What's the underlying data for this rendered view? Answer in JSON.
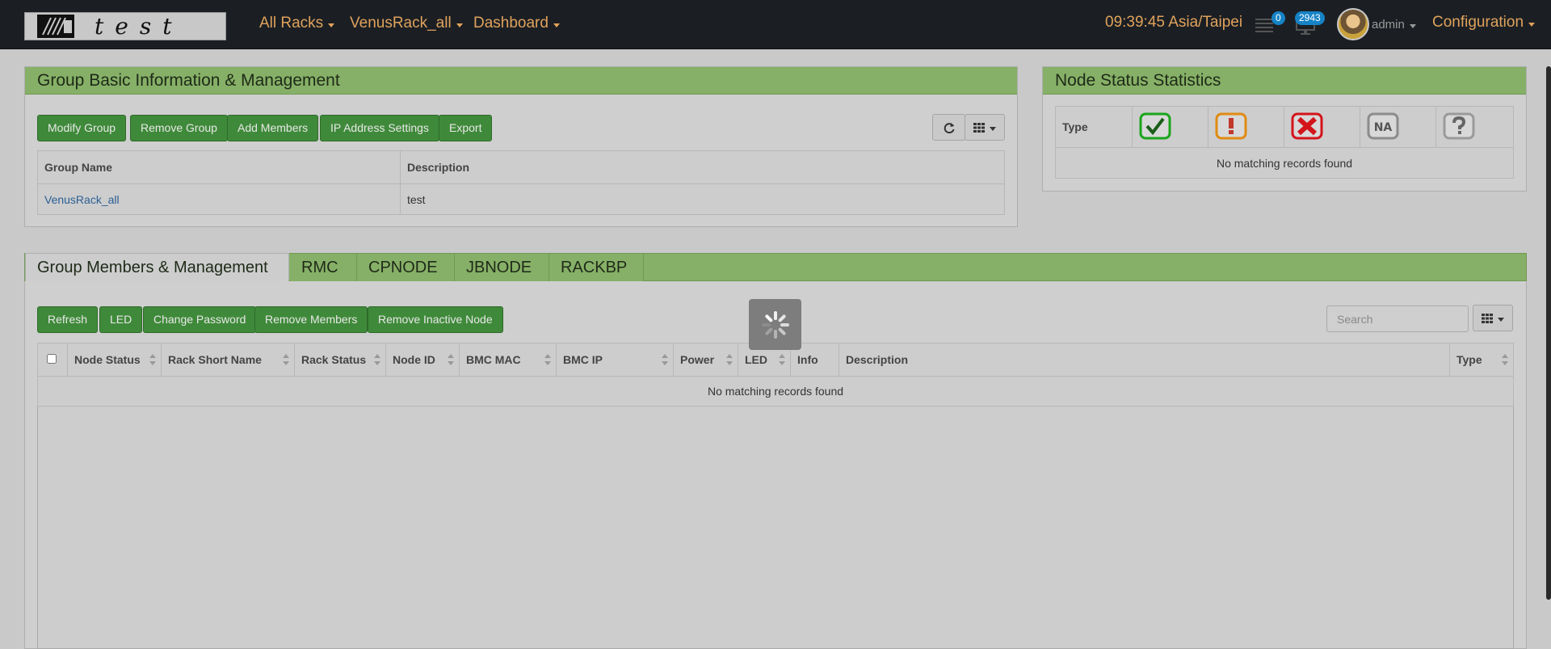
{
  "brand": {
    "logo_text": "test"
  },
  "nav": {
    "menus": [
      {
        "label": "All Racks"
      },
      {
        "label": "VenusRack_all"
      },
      {
        "label": "Dashboard"
      }
    ],
    "clock": "09:39:45 Asia/Taipei",
    "notifications_count": "0",
    "alerts_count": "2943",
    "user": "admin",
    "configuration": "Configuration"
  },
  "group_info": {
    "title": "Group Basic Information & Management",
    "buttons": [
      "Modify Group",
      "Remove Group",
      "Add Members",
      "IP Address Settings",
      "Export"
    ],
    "columns": [
      "Group Name",
      "Description"
    ],
    "rows": [
      {
        "name": "VenusRack_all",
        "description": "test"
      }
    ]
  },
  "node_stats": {
    "title": "Node Status Statistics",
    "type_label": "Type",
    "icons": [
      "ok-status-icon",
      "warning-status-icon",
      "error-status-icon",
      "na-status-icon",
      "unknown-status-icon"
    ],
    "status_colors": {
      "ok": "#1aa51a",
      "warning": "#e08b12",
      "error": "#d4141b",
      "na": "#8c8c8c",
      "unknown": "#9a9a9a"
    },
    "na_text": "NA",
    "empty": "No matching records found"
  },
  "members": {
    "tabs": [
      "Group Members & Management",
      "RMC",
      "CPNODE",
      "JBNODE",
      "RACKBP"
    ],
    "buttons": [
      "Refresh",
      "LED",
      "Change Password",
      "Remove Members",
      "Remove Inactive Node"
    ],
    "search_placeholder": "Search",
    "columns": [
      "Node Status",
      "Rack Short Name",
      "Rack Status",
      "Node ID",
      "BMC MAC",
      "BMC IP",
      "Power",
      "LED",
      "Info",
      "Description",
      "Type"
    ],
    "empty": "No matching records found"
  },
  "colors": {
    "navbar": "#1b1f24",
    "nav_text": "#e0a25c",
    "panel_header": "#86b067",
    "button": "#3f8a3a",
    "badge": "#1683c6"
  }
}
